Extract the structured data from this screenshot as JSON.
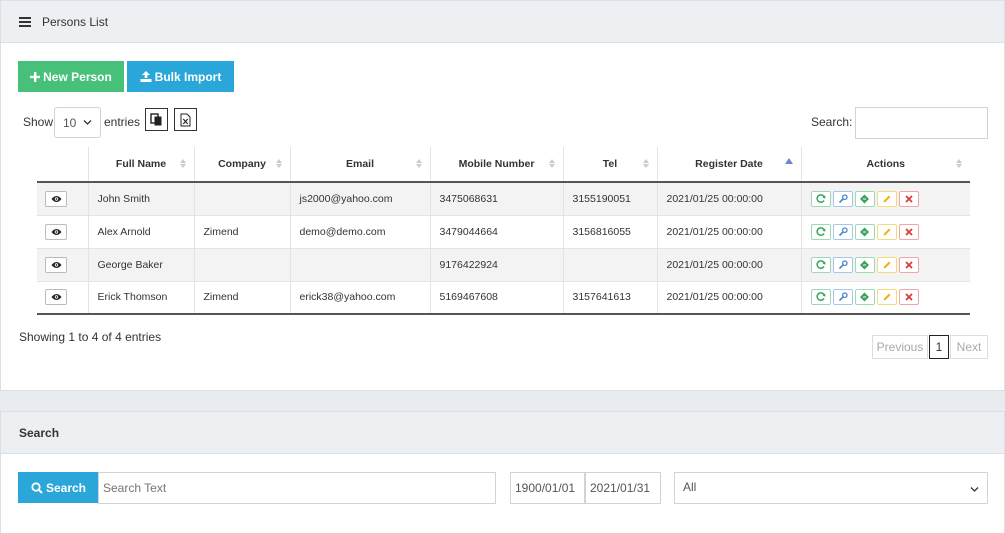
{
  "header": {
    "title": "Persons List"
  },
  "toolbar": {
    "new_person": "New Person",
    "bulk_import": "Bulk Import"
  },
  "length": {
    "show": "Show",
    "value": "10",
    "entries": "entries"
  },
  "search": {
    "label": "Search:",
    "value": ""
  },
  "table": {
    "columns": [
      "",
      "Full Name",
      "Company",
      "Email",
      "Mobile Number",
      "Tel",
      "Register Date",
      "Actions"
    ],
    "rows": [
      {
        "name": "John Smith",
        "company": "",
        "email": "js2000@yahoo.com",
        "mobile": "3475068631",
        "tel": "3155190051",
        "date": "2021/01/25 00:00:00"
      },
      {
        "name": "Alex Arnold",
        "company": "Zimend",
        "email": "demo@demo.com",
        "mobile": "3479044664",
        "tel": "3156816055",
        "date": "2021/01/25 00:00:00"
      },
      {
        "name": "George Baker",
        "company": "",
        "email": "",
        "mobile": "9176422924",
        "tel": "",
        "date": "2021/01/25 00:00:00"
      },
      {
        "name": "Erick Thomson",
        "company": "Zimend",
        "email": "erick38@yahoo.com",
        "mobile": "5169467608",
        "tel": "3157641613",
        "date": "2021/01/25 00:00:00"
      }
    ]
  },
  "info": "Showing 1 to 4 of 4 entries",
  "pagination": {
    "previous": "Previous",
    "page": "1",
    "next": "Next"
  },
  "search_panel": {
    "title": "Search",
    "button": "Search",
    "placeholder": "Search Text",
    "date_from": "1900/01/01",
    "date_to": "2021/01/31",
    "filter": "All"
  },
  "colors": {
    "green": "#47c07a",
    "blue": "#2aa7d8",
    "sort_active": "#6f85c9"
  }
}
